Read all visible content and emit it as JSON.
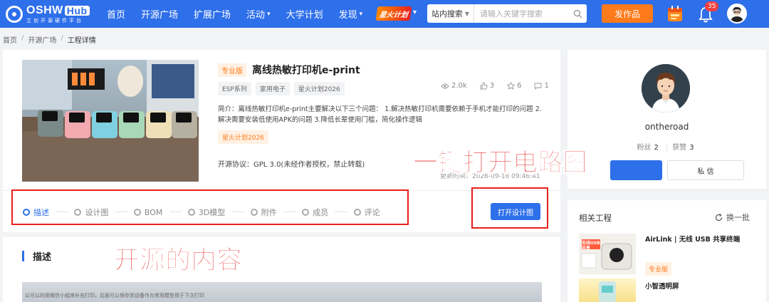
{
  "nav": {
    "logo_main": "OSHW",
    "logo_hub": "Hub",
    "logo_sub": "立创开源硬件平台",
    "items": [
      {
        "label": "首页",
        "caret": false
      },
      {
        "label": "开源广场",
        "caret": false
      },
      {
        "label": "扩展广场",
        "caret": false
      },
      {
        "label": "活动",
        "caret": true
      },
      {
        "label": "大学计划",
        "caret": false
      },
      {
        "label": "发现",
        "caret": true
      }
    ],
    "spark_label": "星火计划",
    "search_scope": "站内搜索",
    "search_placeholder": "请输入关键字搜索",
    "publish_label": "发作品",
    "notification_count": "35",
    "brand_color": "#2e6fea"
  },
  "breadcrumb": [
    "首页",
    "开源广场",
    "工程详情"
  ],
  "project": {
    "pro_tag": "专业版",
    "title": "离线热敏打印机e-print",
    "tags": [
      "ESP系列",
      "家用电子",
      "星火计划2026"
    ],
    "stats": {
      "views": "2.0k",
      "likes": "3",
      "favorites": "6",
      "comments": "1"
    },
    "intro": "简介：离线热敏打印机e-print主要解决以下三个问题： 1.解决热敏打印机需要依赖于手机才能打印的问题 2.解决需要安装低使用APK的问题 3.降低长辈使用门槛，简化操作逻辑",
    "spark_tag": "星火计划2026",
    "license": "开源协议：GPL 3.0(未经作者授权，禁止转载)",
    "created_label": "创",
    "updated": "更新时间：2026-09-16 09:46:41",
    "open_design_label": "打开设计图"
  },
  "steps": [
    {
      "label": "描述",
      "active": true
    },
    {
      "label": "设计图",
      "active": false
    },
    {
      "label": "BOM",
      "active": false
    },
    {
      "label": "3D模型",
      "active": false
    },
    {
      "label": "附件",
      "active": false
    },
    {
      "label": "成员",
      "active": false
    },
    {
      "label": "评论",
      "active": false
    }
  ],
  "annotations": {
    "open_circuit": "一键打开电路图",
    "open_content": "开源的内容"
  },
  "description": {
    "title": "描述",
    "image_caption": "以可以利用微信小程序补充打印，后面可以保存到设备作为常用模型用于下次打印"
  },
  "user": {
    "name": "ontheroad",
    "fans_label": "粉丝",
    "fans": "2",
    "likes_label": "获赞",
    "likes": "3",
    "message_label": "私 信"
  },
  "related": {
    "title": "相关工程",
    "swap_label": "换一批",
    "items": [
      {
        "name": "AirLink | 无线 USB 共享终端",
        "tag": "专业版",
        "image_text": "无线USB 共享"
      },
      {
        "name": "小智透明屏",
        "tag": ""
      }
    ]
  },
  "colors": {
    "accent": "#2e6fea",
    "orange": "#ff7a1a",
    "annotation_red": "#e81f1f"
  }
}
